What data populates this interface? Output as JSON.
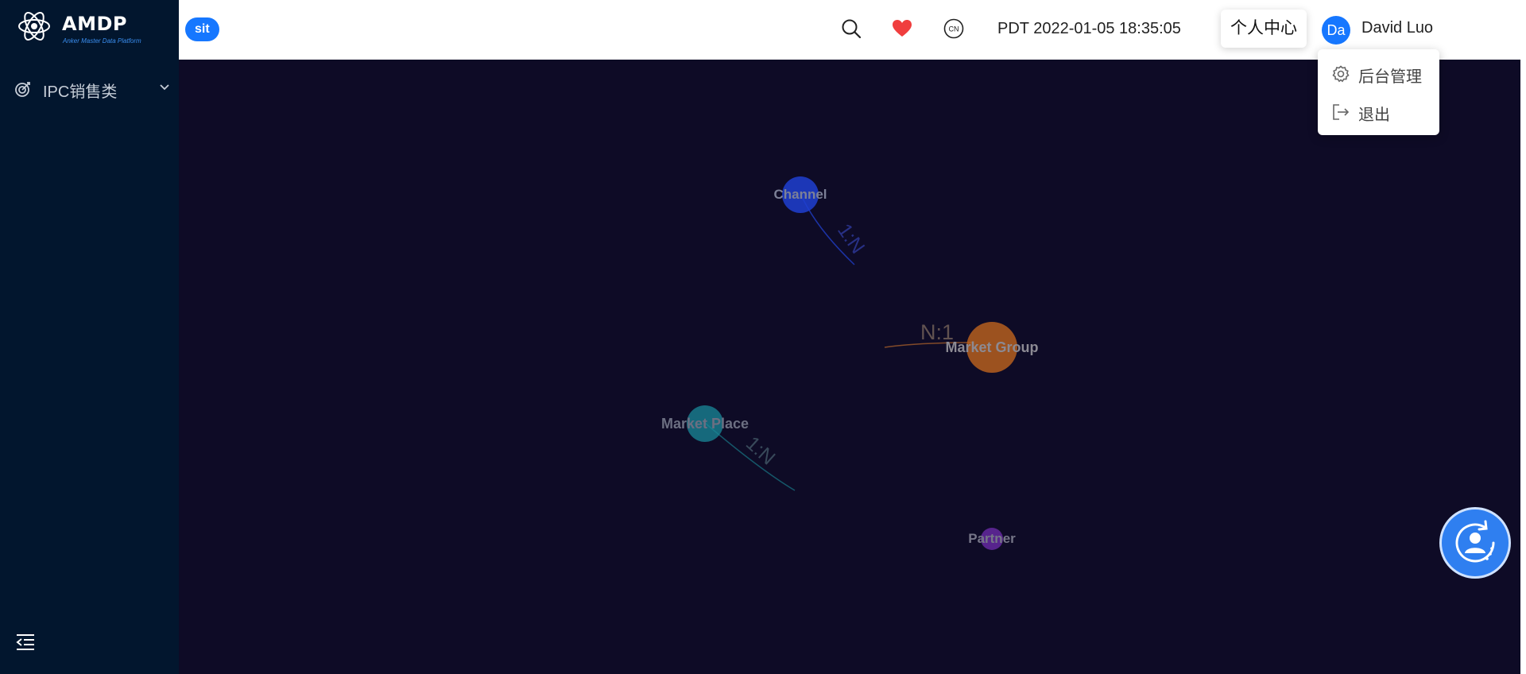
{
  "app": {
    "logo_title": "AMDP",
    "logo_subtitle": "Anker Master Data Platform",
    "environment_badge": "sit"
  },
  "sidebar": {
    "items": [
      {
        "label": "IPC销售类",
        "icon": "target-icon",
        "expanded": false
      }
    ],
    "collapse_icon": "menu-fold-icon"
  },
  "header": {
    "icons": [
      "search-icon",
      "heart-icon",
      "language-cn-icon"
    ],
    "language_icon_text": "CN",
    "clock": "PDT 2022-01-05 18:35:05",
    "tooltip": "个人中心",
    "user": {
      "avatar_text": "Da",
      "name": "David Luo"
    }
  },
  "user_menu": {
    "items": [
      {
        "label": "后台管理",
        "icon": "gear-icon"
      },
      {
        "label": "退出",
        "icon": "logout-icon"
      }
    ]
  },
  "graph": {
    "nodes": [
      {
        "label": "Channel",
        "color": "#1f3fd1"
      },
      {
        "label": "Market Group",
        "color": "#c0641e"
      },
      {
        "label": "Market Place",
        "color": "#1a8a9a"
      },
      {
        "label": "Partner",
        "color": "#6a2aa8"
      }
    ],
    "edges": [
      {
        "from": "Channel",
        "label": "1:N",
        "color": "#2244dd"
      },
      {
        "from": "Market Group",
        "label": "N:1",
        "color": "#b5672b"
      },
      {
        "from": "Market Place",
        "label": "1:N",
        "color": "#1b8a96"
      }
    ]
  },
  "colors": {
    "canvas_background": "#0e0b26",
    "sidebar_background": "#02162e",
    "accent": "#1677ff",
    "favorite": "#f03e3e"
  },
  "floating_action": {
    "icon": "user-sync-icon"
  }
}
